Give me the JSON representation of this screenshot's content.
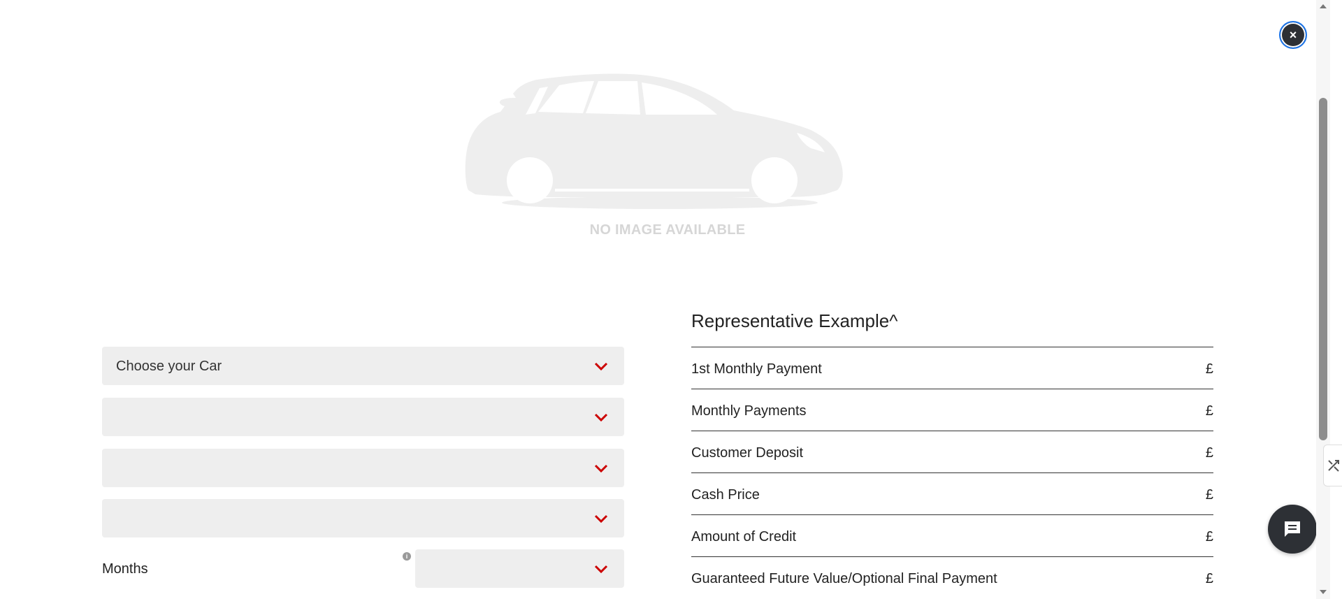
{
  "header": {
    "close_label": "×"
  },
  "hero": {
    "placeholder_text": "NO IMAGE AVAILABLE"
  },
  "form": {
    "car_select": "Choose your Car",
    "select_2": "",
    "select_3": "",
    "select_4": "",
    "months_label": "Months",
    "info_glyph": "i",
    "months_value": ""
  },
  "representative": {
    "title": "Representative Example^",
    "rows": [
      {
        "label": "1st Monthly Payment",
        "amount": "£"
      },
      {
        "label": "Monthly Payments",
        "amount": "£"
      },
      {
        "label": "Customer Deposit",
        "amount": "£"
      },
      {
        "label": "Cash Price",
        "amount": "£"
      },
      {
        "label": "Amount of Credit",
        "amount": "£"
      },
      {
        "label": "Guaranteed Future Value/Optional Final Payment",
        "amount": "£"
      }
    ]
  },
  "colors": {
    "accent_red": "#cc0000",
    "dark_button": "#2d3035",
    "focus_ring": "#1a73e8",
    "field_bg": "#eeeeee"
  },
  "icons": {
    "close": "close-icon",
    "chevron": "chevron-down-icon",
    "chat": "chat-icon",
    "info": "info-icon"
  }
}
